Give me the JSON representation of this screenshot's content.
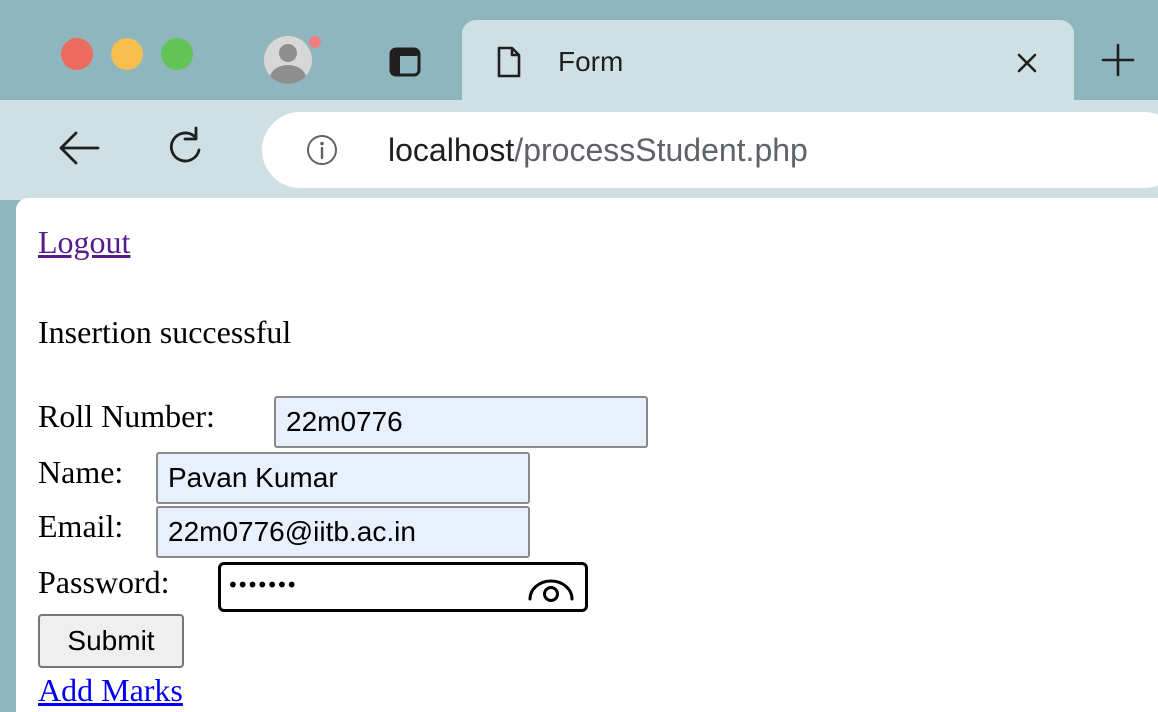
{
  "browser": {
    "tab_title": "Form",
    "url_host": "localhost",
    "url_path": "/processStudent.php"
  },
  "page": {
    "logout_link": "Logout",
    "message": "Insertion successful",
    "form": {
      "roll_label": "Roll Number:",
      "roll_value": "22m0776",
      "name_label": "Name:",
      "name_value": "Pavan Kumar",
      "email_label": "Email:",
      "email_value": "22m0776@iitb.ac.in",
      "password_label": "Password:",
      "password_mask": "•••••••",
      "submit_label": "Submit"
    },
    "add_marks_link": "Add Marks"
  },
  "icons": {
    "window_controls": [
      "close",
      "minimize",
      "zoom"
    ],
    "profile": "profile-avatar-icon",
    "sidebar": "sidebar-toggle-icon",
    "tab": "document-icon",
    "tab_close": "close-icon",
    "new_tab": "plus-icon",
    "back": "back-arrow-icon",
    "reload": "reload-icon",
    "site_info": "info-icon",
    "reveal_password": "eye-icon"
  },
  "colors": {
    "frame": "#8fb6bf",
    "toolbar": "#cfe0e4",
    "autofill": "#e8f0fe",
    "visited_link": "#551a8b",
    "link": "#0000ee"
  }
}
